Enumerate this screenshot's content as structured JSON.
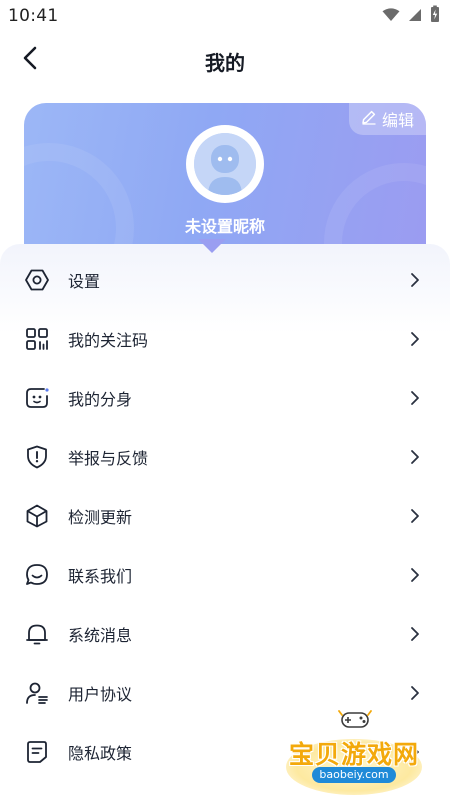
{
  "status_bar": {
    "time": "10:41",
    "icons": [
      "wifi-icon",
      "signal-icon",
      "battery-charging-icon"
    ]
  },
  "header": {
    "title": "我的",
    "back_icon": "chevron-left-icon"
  },
  "profile": {
    "edit_label": "编辑",
    "nickname": "未设置昵称",
    "card_gradient": [
      "#9cb7f6",
      "#9b9cf1"
    ]
  },
  "menu": [
    {
      "id": "settings",
      "label": "设置",
      "icon": "hexagon-settings-icon"
    },
    {
      "id": "follow-code",
      "label": "我的关注码",
      "icon": "qr-grid-icon"
    },
    {
      "id": "avatar-clone",
      "label": "我的分身",
      "icon": "face-chat-icon"
    },
    {
      "id": "report",
      "label": "举报与反馈",
      "icon": "shield-alert-icon"
    },
    {
      "id": "update",
      "label": "检测更新",
      "icon": "cube-icon"
    },
    {
      "id": "contact",
      "label": "联系我们",
      "icon": "chat-smile-icon"
    },
    {
      "id": "messages",
      "label": "系统消息",
      "icon": "bell-icon"
    },
    {
      "id": "agreement",
      "label": "用户协议",
      "icon": "user-list-icon"
    },
    {
      "id": "privacy",
      "label": "隐私政策",
      "icon": "document-icon"
    }
  ],
  "watermark": {
    "brand": "宝贝游戏网",
    "url": "baobeiy.com"
  },
  "colors": {
    "text": "#1d2433",
    "accent": "#9aa5f3",
    "icon_stroke": "#1d2433",
    "arrow": "#2a3140"
  }
}
